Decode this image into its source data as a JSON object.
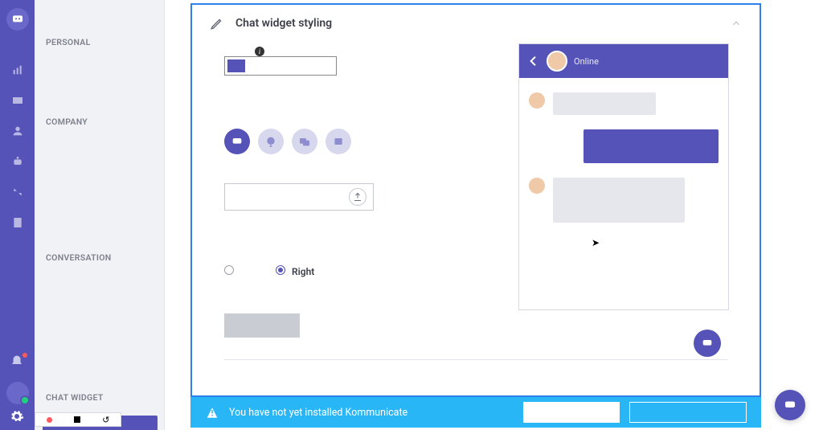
{
  "colors": {
    "primary": "#5553b7",
    "banner": "#29b6f6"
  },
  "sidebar": {
    "sections": {
      "personal": "PERSONAL",
      "company": "COMPANY",
      "conversation": "CONVERSATION",
      "chat_widget": "CHAT WIDGET"
    }
  },
  "panel": {
    "title": "Chat widget styling",
    "color_value": "#5553b7",
    "position": {
      "left_label": "",
      "right_label": "Right",
      "selected": "right"
    }
  },
  "preview": {
    "status": "Online"
  },
  "banner": {
    "text": "You have not yet installed Kommunicate"
  }
}
